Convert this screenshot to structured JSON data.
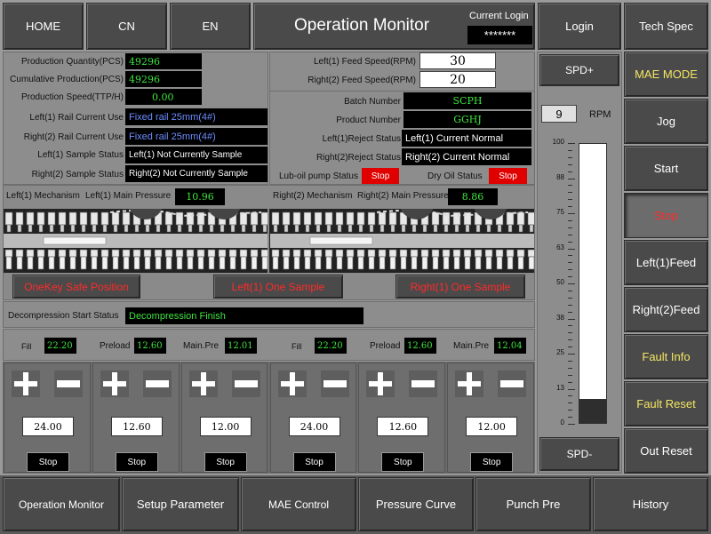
{
  "header": {
    "home": "HOME",
    "cn": "CN",
    "en": "EN",
    "title": "Operation Monitor",
    "current_login_label": "Current Login",
    "current_login_value": "*******",
    "login": "Login",
    "tech_spec": "Tech Spec"
  },
  "production": {
    "qty_label": "Production Quantity(PCS)",
    "qty_value": "49296",
    "cum_label": "Cumulative Production(PCS)",
    "cum_value": "49296",
    "speed_label": "Production Speed(TTP/H)",
    "speed_value": "0.00",
    "left_rail_label": "Left(1) Rail Current Use",
    "left_rail_value": "Fixed rail 25mm(4#)",
    "right_rail_label": "Right(2) Rail Current Use",
    "right_rail_value": "Fixed rail 25mm(4#)",
    "left_sample_label": "Left(1) Sample Status",
    "left_sample_value": "Left(1) Not Currently Sample",
    "right_sample_label": "Right(2) Sample Status",
    "right_sample_value": "Right(2) Not Currently Sample"
  },
  "feed": {
    "left_label": "Left(1) Feed Speed(RPM)",
    "left_value": "30",
    "right_label": "Right(2) Feed Speed(RPM)",
    "right_value": "20",
    "batch_label": "Batch Number",
    "batch_value": "SCPH",
    "product_label": "Product Number",
    "product_value": "GGHJ",
    "left_reject_label": "Left(1)Reject Status",
    "left_reject_value": "Left(1) Current Normal",
    "right_reject_label": "Right(2)Reject Status",
    "right_reject_value": "Right(2) Current Normal",
    "lub_label": "Lub-oil pump Status",
    "lub_value": "Stop",
    "dry_label": "Dry Oil Status",
    "dry_value": "Stop"
  },
  "mechanism": {
    "left_title": "Left(1) Mechanism",
    "left_pressure_label": "Left(1) Main Pressure",
    "left_pressure_value": "10.96",
    "right_title": "Right(2) Mechanism",
    "right_pressure_label": "Right(2) Main Pressure",
    "right_pressure_value": "8.86"
  },
  "actions": {
    "onekey": "OneKey Safe Position",
    "left_sample": "Left(1) One Sample",
    "right_sample": "Right(1) One Sample"
  },
  "decompression": {
    "label": "Decompression Start Status",
    "value": "Decompression Finish"
  },
  "pressures": {
    "fill_label": "Fill",
    "preload_label": "Preload",
    "main_label": "Main.Pre",
    "left": {
      "fill": "22.20",
      "preload": "12.60",
      "main": "12.01"
    },
    "right": {
      "fill": "22.20",
      "preload": "12.60",
      "main": "12.04"
    }
  },
  "controls": {
    "setpoints": [
      "24.00",
      "12.60",
      "12.00",
      "24.00",
      "12.60",
      "12.00"
    ],
    "stop_label": "Stop"
  },
  "speed_panel": {
    "spd_plus": "SPD+",
    "spd_minus": "SPD-",
    "rpm_value": "9",
    "rpm_unit": "RPM",
    "gauge_level_percent": 9,
    "ticks": [
      "100",
      "88",
      "75",
      "63",
      "50",
      "38",
      "25",
      "13",
      "0"
    ]
  },
  "right_menu": {
    "mae_mode": "MAE MODE",
    "jog": "Jog",
    "start": "Start",
    "stop": "Stop",
    "left_feed": "Left(1)Feed",
    "right_feed": "Right(2)Feed",
    "fault_info": "Fault Info",
    "fault_reset": "Fault Reset",
    "out_reset": "Out Reset"
  },
  "bottom_nav": [
    "Operation Monitor",
    "Setup Parameter",
    "MAE Control",
    "Pressure Curve",
    "Punch Pre",
    "History"
  ],
  "colors": {
    "accent_yellow": "#f5e663",
    "alarm_red": "#e00000",
    "value_green": "#3ee53e",
    "value_blue": "#6d8cff"
  }
}
